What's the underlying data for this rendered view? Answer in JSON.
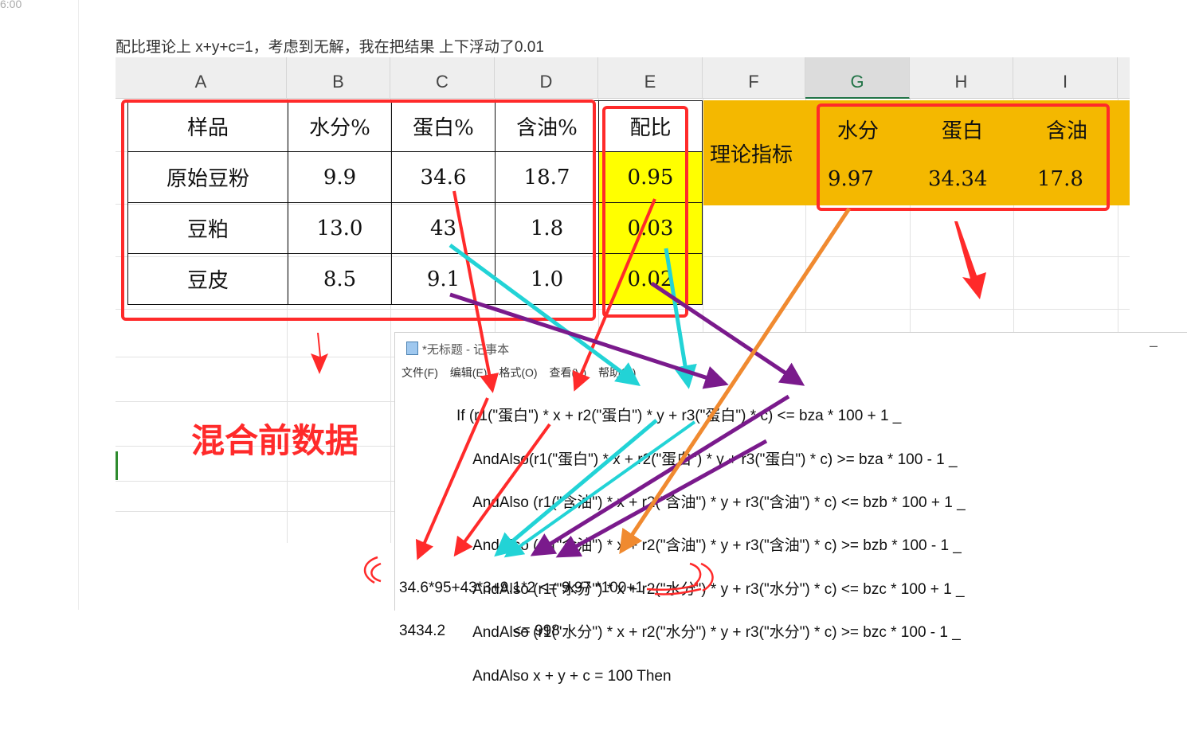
{
  "page": {
    "timestamp": "6:00",
    "intro": "配比理论上 x+y+c=1，考虑到无解，我在把结果 上下浮动了0.01",
    "annotation_label": "混合前数据"
  },
  "sheet": {
    "columns": [
      "A",
      "B",
      "C",
      "D",
      "E",
      "F",
      "G",
      "H",
      "I"
    ],
    "active_column": "G",
    "table_header": [
      "样品",
      "水分%",
      "蛋白%",
      "含油%"
    ],
    "rows": [
      [
        "原始豆粉",
        "9.9",
        "34.6",
        "18.7"
      ],
      [
        "豆粕",
        "13.0",
        "43",
        "1.8"
      ],
      [
        "豆皮",
        "8.5",
        "9.1",
        "1.0"
      ]
    ],
    "ratio_header": "配比",
    "ratios": [
      "0.95",
      "0.03",
      "0.02"
    ],
    "theory_label": "理论指标",
    "theory_headers": [
      "水分",
      "蛋白",
      "含油"
    ],
    "theory_values": [
      "9.97",
      "34.34",
      "17.8"
    ]
  },
  "notepad": {
    "title": "*无标题 - 记事本",
    "minimize": "–",
    "menu": [
      "文件(F)",
      "编辑(E)",
      "格式(O)",
      "查看(V)",
      "帮助(H)"
    ],
    "code": [
      "If (r1(\"蛋白\") * x + r2(\"蛋白\") * y + r3(\"蛋白\") * c) <= bza * 100 + 1 _",
      "    AndAlso(r1(\"蛋白\") * x + r2(\"蛋白\") * y + r3(\"蛋白\") * c) >= bza * 100 - 1 _",
      "    AndAlso (r1(\"含油\") * x + r2(\"含油\") * y + r3(\"含油\") * c) <= bzb * 100 + 1 _",
      "    AndAlso (r1(\"含油\") * x + r2(\"含油\") * y + r3(\"含油\") * c) >= bzb * 100 - 1 _",
      "    AndAlso (r1(\"水分\") * x + r2(\"水分\") * y + r3(\"水分\") * c) <= bzc * 100 + 1 _",
      "    AndAlso (r1(\"水分\") * x + r2(\"水分\") * y + r3(\"水分\") * c) >= bzc * 100 - 1 _",
      "    AndAlso x + y + c = 100 Then"
    ],
    "calc_line1": "34.6*95+43*3+9.1*2 <= 9.97 *100+1",
    "calc_line2": "3434.2                <= 998"
  },
  "colors": {
    "red": "#ff2a2a",
    "cyan": "#22d3d6",
    "purple": "#7a1a8c",
    "orange": "#f08a30",
    "yellow": "#ffff00",
    "gold": "#f4b800"
  }
}
